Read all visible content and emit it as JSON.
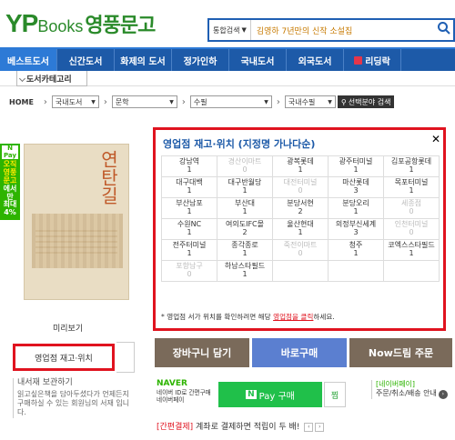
{
  "logo": {
    "yp": "YP",
    "books": "Books",
    "name": "영풍문고"
  },
  "search": {
    "scope": "통합검색",
    "value": "김영하 7년만의 신작 소설집"
  },
  "nav": [
    "베스트도서",
    "신간도서",
    "화제의 도서",
    "정가인하",
    "국내도서",
    "외국도서",
    "리딩락"
  ],
  "category_button": "도서카테고리",
  "breadcrumb": {
    "home": "HOME",
    "levels": [
      "국내도서",
      "문학",
      "수필",
      "국내수필"
    ],
    "go": "선택분야 검색"
  },
  "book": {
    "title": "연탄길"
  },
  "npay_badge": {
    "pay": "N Pay",
    "lines": [
      "오직",
      "영풍",
      "문고",
      "에서만",
      "최대",
      "4%"
    ]
  },
  "preview": "미리보기",
  "stock_button": "영업점 재고·위치",
  "wishlist": {
    "title": "내서재 보관하기",
    "desc": "읽고싶은책을 담아두셨다가 언제든지 구매하실 수 있는 회원님의 서재 입니다."
  },
  "popup": {
    "title": "영업점 재고·위치 (지정명 가나다순)",
    "stores": [
      {
        "name": "강남역",
        "count": "1",
        "zero": false
      },
      {
        "name": "경산이마트",
        "count": "0",
        "zero": true
      },
      {
        "name": "광복롯데",
        "count": "1",
        "zero": false
      },
      {
        "name": "광주터미널",
        "count": "1",
        "zero": false
      },
      {
        "name": "김포공항롯데",
        "count": "1",
        "zero": false
      },
      {
        "name": "대구대백",
        "count": "1",
        "zero": false
      },
      {
        "name": "대구반월당",
        "count": "1",
        "zero": false
      },
      {
        "name": "대전터미널",
        "count": "0",
        "zero": true
      },
      {
        "name": "마산롯데",
        "count": "3",
        "zero": false
      },
      {
        "name": "목포터미널",
        "count": "1",
        "zero": false
      },
      {
        "name": "부산남포",
        "count": "1",
        "zero": false
      },
      {
        "name": "부산대",
        "count": "1",
        "zero": false
      },
      {
        "name": "분당서현",
        "count": "2",
        "zero": false
      },
      {
        "name": "분당오리",
        "count": "1",
        "zero": false
      },
      {
        "name": "세종점",
        "count": "0",
        "zero": true
      },
      {
        "name": "수원NC",
        "count": "1",
        "zero": false
      },
      {
        "name": "여의도IFC몰",
        "count": "2",
        "zero": false
      },
      {
        "name": "울산현대",
        "count": "1",
        "zero": false
      },
      {
        "name": "의정부신세계",
        "count": "3",
        "zero": false
      },
      {
        "name": "인천터미널",
        "count": "0",
        "zero": true
      },
      {
        "name": "전주터미널",
        "count": "1",
        "zero": false
      },
      {
        "name": "종각종로",
        "count": "1",
        "zero": false
      },
      {
        "name": "죽전이마트",
        "count": "0",
        "zero": true
      },
      {
        "name": "청주",
        "count": "1",
        "zero": false
      },
      {
        "name": "코엑스스타필드",
        "count": "1",
        "zero": false
      },
      {
        "name": "포항남구",
        "count": "0",
        "zero": true
      },
      {
        "name": "하남스타필드",
        "count": "1",
        "zero": false
      }
    ],
    "note_prefix": "* 영업점 서가 위치를 확인하려면 해당 ",
    "note_link": "영업점을 클릭",
    "note_suffix": "하세요."
  },
  "actions": {
    "cart": "장바구니 담기",
    "buy": "바로구매",
    "now": "Now드림 주문"
  },
  "naver": {
    "logo": "NAVER",
    "l1": "네이버 ID로 간편구매",
    "l2": "네이버페이"
  },
  "npay_button": {
    "n": "N",
    "label": "Pay 구매"
  },
  "zzim": "찜",
  "npay_info": {
    "label": "[네이버페이]",
    "text": "주문/취소/배송 안내"
  },
  "easy_pay": {
    "tag": "[간편결제]",
    "text": "계좌로 결제하면 적립이 두 배!"
  }
}
